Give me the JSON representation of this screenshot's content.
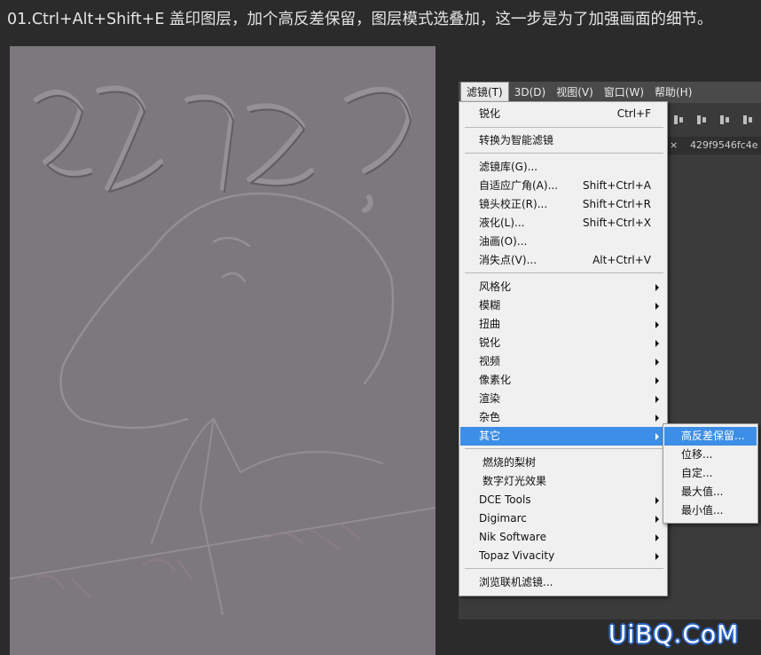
{
  "caption": "01.Ctrl+Alt+Shift+E 盖印图层，加个高反差保留，图层模式选叠加，这一步是为了加强画面的细节。",
  "canvas": {
    "title_glyphs": "狗吗?",
    "small_glyphs": "值不",
    "bottom_glyphs": "靠谱 · 省心 · 有想法"
  },
  "menubar": {
    "items": [
      "滤镜(T)",
      "3D(D)",
      "视图(V)",
      "窗口(W)",
      "帮助(H)"
    ],
    "active_index": 0
  },
  "toolbar_icons": [
    "align-bottom-icon",
    "align-hcenter-icon",
    "align-right-icon",
    "distribute-icon"
  ],
  "document_tab": {
    "close": "×",
    "name": "429f9546fc4e"
  },
  "filter_menu": {
    "items": [
      {
        "label": "锐化",
        "shortcut": "Ctrl+F"
      },
      {
        "label": "转换为智能滤镜",
        "shortcut": ""
      },
      {
        "label": "滤镜库(G)...",
        "shortcut": ""
      },
      {
        "label": "自适应广角(A)...",
        "shortcut": "Shift+Ctrl+A"
      },
      {
        "label": "镜头校正(R)...",
        "shortcut": "Shift+Ctrl+R"
      },
      {
        "label": "液化(L)...",
        "shortcut": "Shift+Ctrl+X"
      },
      {
        "label": "油画(O)...",
        "shortcut": ""
      },
      {
        "label": "消失点(V)...",
        "shortcut": "Alt+Ctrl+V"
      },
      {
        "label": "风格化",
        "submenu": true
      },
      {
        "label": "模糊",
        "submenu": true
      },
      {
        "label": "扭曲",
        "submenu": true
      },
      {
        "label": "锐化",
        "submenu": true
      },
      {
        "label": "视频",
        "submenu": true
      },
      {
        "label": "像素化",
        "submenu": true
      },
      {
        "label": "渲染",
        "submenu": true
      },
      {
        "label": "杂色",
        "submenu": true
      },
      {
        "label": "其它",
        "submenu": true,
        "highlighted": true
      },
      {
        "label": "燃烧的梨树",
        "submenu": false
      },
      {
        "label": "数字灯光效果",
        "submenu": false
      },
      {
        "label": "DCE Tools",
        "submenu": true
      },
      {
        "label": "Digimarc",
        "submenu": true
      },
      {
        "label": "Nik Software",
        "submenu": true
      },
      {
        "label": "Topaz Vivacity",
        "submenu": true
      },
      {
        "label": "浏览联机滤镜...",
        "submenu": false
      }
    ]
  },
  "other_submenu": {
    "items": [
      "高反差保留...",
      "位移...",
      "自定...",
      "最大值...",
      "最小值..."
    ],
    "highlighted_index": 0
  },
  "watermark": "UiBQ.CoM",
  "colors": {
    "menu_highlight": "#3d8ee6",
    "canvas_gray": "#7d777e",
    "watermark_outline": "#2a66c8"
  }
}
